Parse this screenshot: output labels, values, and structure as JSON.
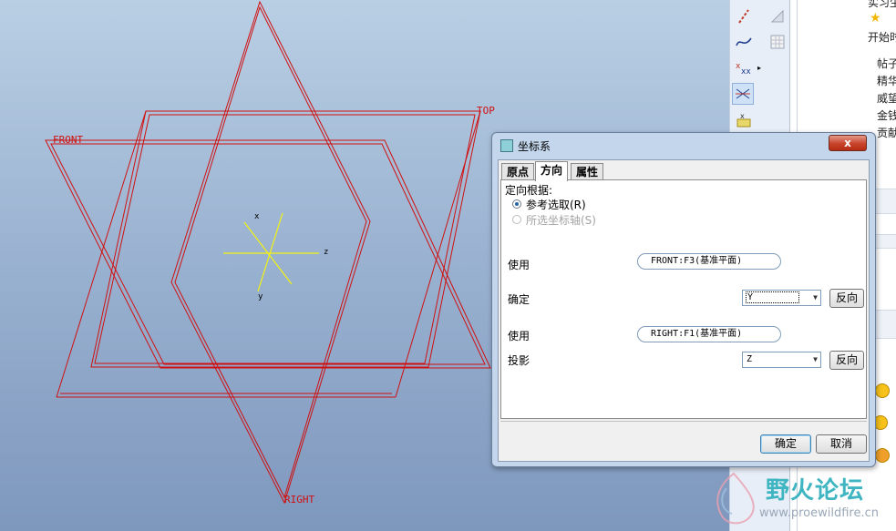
{
  "viewport": {
    "datum_planes": {
      "top": "TOP",
      "front": "FRONT",
      "right": "RIGHT"
    },
    "csys_axes": {
      "x": "x",
      "y": "y",
      "z": "z"
    },
    "colors": {
      "plane": "#d01010",
      "csys": "#f3f30f",
      "background_top": "#b9cfe4",
      "background_bottom": "#7e97bd"
    }
  },
  "toolbar": {
    "tools": [
      "sketch-line-icon",
      "spline-icon",
      "datum-point-icon",
      "coordinate-system-icon",
      "analysis-icon",
      "select-icon",
      "grid-icon"
    ]
  },
  "dialog": {
    "title": "坐标系",
    "close_label": "x",
    "tabs": [
      {
        "label": "原点",
        "active": false
      },
      {
        "label": "方向",
        "active": true
      },
      {
        "label": "属性",
        "active": false
      }
    ],
    "orient_by_label": "定向根据:",
    "option_ref": "参考选取(R)",
    "option_axes": "所选坐标轴(S)",
    "use1_label": "使用",
    "use1_value": "FRONT:F3(基准平面)",
    "determine_label": "确定",
    "determine_value": "Y",
    "flip1_label": "反向",
    "use2_label": "使用",
    "use2_value": "RIGHT:F1(基准平面)",
    "projection_label": "投影",
    "projection_value": "Z",
    "flip2_label": "反向",
    "ok_label": "确定",
    "cancel_label": "取消"
  },
  "sidebar": {
    "top_text": "实习生",
    "start_text": "开始时",
    "items": [
      "帖子",
      "精华",
      "威望",
      "金钱",
      "贡献"
    ]
  },
  "watermark": {
    "title": "野火论坛",
    "url": "www.proewildfire.cn"
  }
}
